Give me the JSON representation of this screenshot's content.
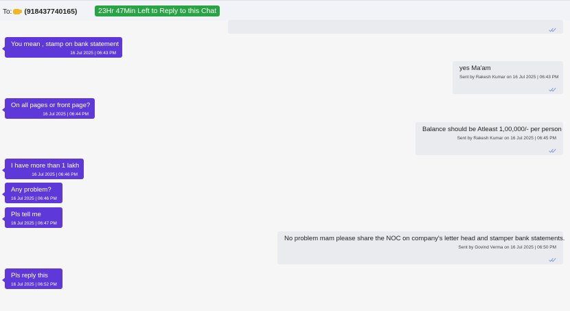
{
  "header": {
    "to_prefix": "To:",
    "phone": "(918437740165)",
    "reply_window": "23Hr 47Min Left to Reply to this Chat"
  },
  "colors": {
    "incoming_bubble": "#5e38d8",
    "outgoing_bubble": "#e9ebef",
    "timer_badge": "#29a444",
    "read_ticks": "#7b96d6"
  },
  "icons": {
    "recipient": "waving-hand-icon",
    "read_receipt": "double-check-icon"
  },
  "messages": [
    {
      "direction": "out",
      "text": "",
      "meta": ""
    },
    {
      "direction": "in",
      "text": "You mean , stamp on bank statement",
      "meta": "16 Jul 2025 | 06:43 PM"
    },
    {
      "direction": "out",
      "text": "yes Ma'am",
      "meta": "Sent by Rakesh Kumar on 16 Jul 2025 | 06:43 PM"
    },
    {
      "direction": "in",
      "text": "On all pages or front page?",
      "meta": "16 Jul 2025 | 06:44 PM"
    },
    {
      "direction": "out",
      "text": "Balance should be Atleast 1,00,000/- per person",
      "meta": "Sent by Rakesh Kumar on 16 Jul 2025 | 06:45 PM"
    },
    {
      "direction": "in",
      "text": "I have more than 1 lakh",
      "meta": "16 Jul 2025 | 06:46 PM"
    },
    {
      "direction": "in",
      "text": "Any problem?",
      "meta": "16 Jul 2025 | 06:46 PM"
    },
    {
      "direction": "in",
      "text": "Pls tell me",
      "meta": "16 Jul 2025 | 06:47 PM"
    },
    {
      "direction": "out",
      "text": "No problem mam please share the NOC on company's letter head and stamper bank statements.",
      "meta": "Sent by Govind Verma on 16 Jul 2025 | 06:50 PM"
    },
    {
      "direction": "in",
      "text": "Pls reply this",
      "meta": "16 Jul 2025 | 06:52 PM"
    }
  ]
}
